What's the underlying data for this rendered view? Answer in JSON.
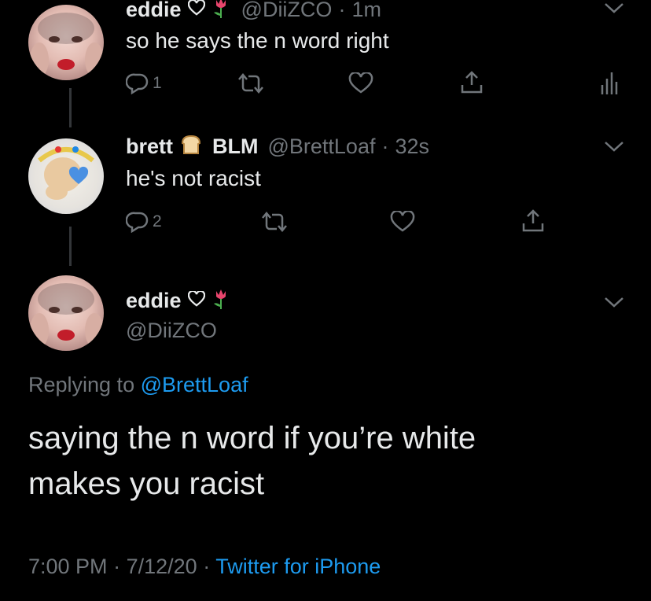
{
  "tweets": [
    {
      "name": "eddie",
      "handle": "@DiiZCO",
      "separator": "·",
      "time": "1m",
      "text": "so he says the n word right",
      "reply_count": "1"
    },
    {
      "name": "brett",
      "name_suffix": "BLM",
      "handle": "@BrettLoaf",
      "separator": "·",
      "time": "32s",
      "text": "he's not racist",
      "reply_count": "2"
    }
  ],
  "main": {
    "name": "eddie",
    "handle": "@DiiZCO",
    "replying_prefix": "Replying to",
    "replying_to": "@BrettLoaf",
    "text_line1": "saying the n word if you’re white",
    "text_line2": "makes you racist",
    "time": "7:00 PM",
    "date": "7/12/20",
    "separator": "·",
    "source": "Twitter for iPhone"
  },
  "colors": {
    "background": "#000000",
    "text": "#e7e9ea",
    "muted": "#71767b",
    "link": "#1d9bf0"
  },
  "icons": [
    "heart-outline-icon",
    "tulip-emoji-icon",
    "bread-emoji-icon",
    "chevron-down-icon",
    "reply-icon",
    "retweet-icon",
    "like-icon",
    "share-icon",
    "analytics-icon"
  ]
}
